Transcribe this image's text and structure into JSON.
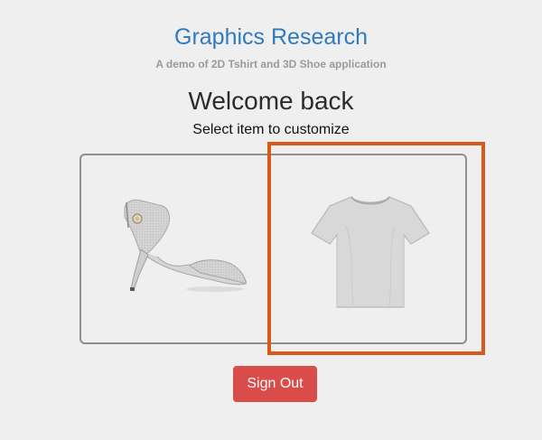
{
  "header": {
    "brand": "Graphics Research",
    "tagline": "A demo of 2D Tshirt and 3D Shoe application"
  },
  "main": {
    "welcome": "Welcome back",
    "prompt": "Select item to customize",
    "items": [
      {
        "icon": "shoe-image"
      },
      {
        "icon": "tshirt-image"
      }
    ],
    "highlight_color": "#d9591b"
  },
  "signout": {
    "label": "Sign Out",
    "color": "#d94c49"
  }
}
